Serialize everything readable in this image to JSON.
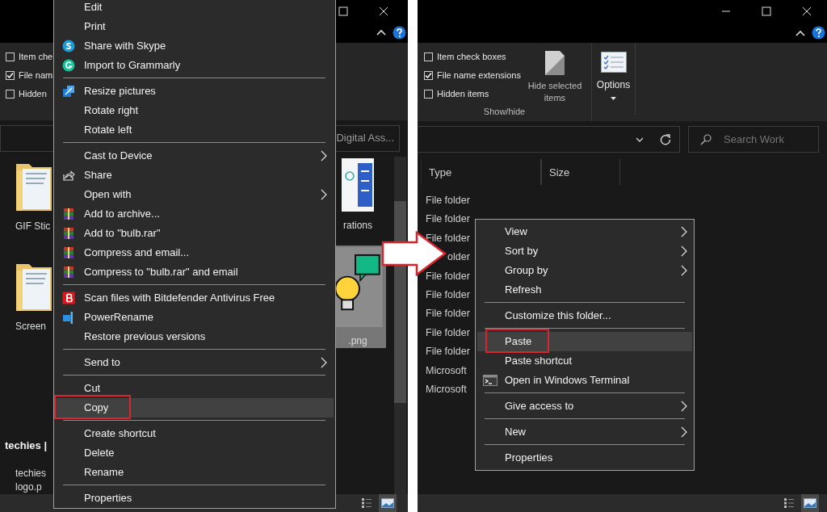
{
  "left_window": {
    "ribbon_checkboxes": [
      {
        "label": "Item che",
        "checked": false
      },
      {
        "label": "File nam",
        "checked": true
      },
      {
        "label": "Hidden",
        "checked": false
      }
    ],
    "address_text": "Digital Ass...",
    "files_left_of_menu": [
      {
        "kind": "folder",
        "name": "GIF Stic"
      },
      {
        "kind": "folder",
        "name": "Screen"
      },
      {
        "kind": "logo",
        "preview_text": "techies |",
        "name_lines": [
          "techies",
          "logo.p"
        ]
      }
    ],
    "files_right_of_menu": [
      {
        "kind": "image",
        "name": "rations",
        "selected": false
      },
      {
        "kind": "bulb",
        "name": ".png",
        "selected": true
      }
    ],
    "context_menu": [
      {
        "kind": "item",
        "label": "Edit",
        "submenu": false,
        "selected": false
      },
      {
        "kind": "item",
        "label": "Print",
        "submenu": false,
        "selected": false
      },
      {
        "kind": "item",
        "label": "Share with Skype",
        "submenu": false,
        "selected": false
      },
      {
        "kind": "item",
        "label": "Import to Grammarly",
        "submenu": false,
        "selected": false
      },
      {
        "kind": "separator"
      },
      {
        "kind": "item",
        "label": "Resize pictures",
        "submenu": false,
        "selected": false
      },
      {
        "kind": "item",
        "label": "Rotate right",
        "submenu": false,
        "selected": false
      },
      {
        "kind": "item",
        "label": "Rotate left",
        "submenu": false,
        "selected": false
      },
      {
        "kind": "separator"
      },
      {
        "kind": "item",
        "label": "Cast to Device",
        "submenu": true,
        "selected": false
      },
      {
        "kind": "item",
        "label": "Share",
        "submenu": false,
        "selected": false
      },
      {
        "kind": "item",
        "label": "Open with",
        "submenu": true,
        "selected": false
      },
      {
        "kind": "item",
        "label": "Add to archive...",
        "submenu": false,
        "selected": false
      },
      {
        "kind": "item",
        "label": "Add to \"bulb.rar\"",
        "submenu": false,
        "selected": false
      },
      {
        "kind": "item",
        "label": "Compress and email...",
        "submenu": false,
        "selected": false
      },
      {
        "kind": "item",
        "label": "Compress to \"bulb.rar\" and email",
        "submenu": false,
        "selected": false
      },
      {
        "kind": "separator"
      },
      {
        "kind": "item",
        "label": "Scan files with Bitdefender Antivirus Free",
        "submenu": false,
        "selected": false
      },
      {
        "kind": "item",
        "label": "PowerRename",
        "submenu": false,
        "selected": false
      },
      {
        "kind": "item",
        "label": "Restore previous versions",
        "submenu": false,
        "selected": false
      },
      {
        "kind": "separator"
      },
      {
        "kind": "item",
        "label": "Send to",
        "submenu": true,
        "selected": false
      },
      {
        "kind": "separator"
      },
      {
        "kind": "item",
        "label": "Cut",
        "submenu": false,
        "selected": false
      },
      {
        "kind": "item",
        "label": "Copy",
        "submenu": false,
        "selected": true
      },
      {
        "kind": "separator"
      },
      {
        "kind": "item",
        "label": "Create shortcut",
        "submenu": false,
        "selected": false
      },
      {
        "kind": "item",
        "label": "Delete",
        "submenu": false,
        "selected": false
      },
      {
        "kind": "item",
        "label": "Rename",
        "submenu": false,
        "selected": false
      },
      {
        "kind": "separator"
      },
      {
        "kind": "item",
        "label": "Properties",
        "submenu": false,
        "selected": false
      }
    ]
  },
  "right_window": {
    "ribbon_checkboxes": [
      {
        "label": "Item check boxes",
        "checked": false
      },
      {
        "label": "File name extensions",
        "checked": true
      },
      {
        "label": "Hidden items",
        "checked": false
      }
    ],
    "hide_selected_button": "Hide selected items",
    "options_button": "Options",
    "group_label": "Show/hide",
    "search": {
      "placeholder": "Search Work"
    },
    "columns": [
      "Type",
      "Size"
    ],
    "rows": [
      "File folder",
      "File folder",
      "File folder",
      "older",
      "File folder",
      "File folder",
      "File folder",
      "File folder",
      "File folder",
      "Microsoft",
      "Microsoft"
    ],
    "context_menu": [
      {
        "kind": "item",
        "label": "View",
        "submenu": true,
        "selected": false
      },
      {
        "kind": "item",
        "label": "Sort by",
        "submenu": true,
        "selected": false
      },
      {
        "kind": "item",
        "label": "Group by",
        "submenu": true,
        "selected": false
      },
      {
        "kind": "item",
        "label": "Refresh",
        "submenu": false,
        "selected": false
      },
      {
        "kind": "separator"
      },
      {
        "kind": "item",
        "label": "Customize this folder...",
        "submenu": false,
        "selected": false
      },
      {
        "kind": "separator"
      },
      {
        "kind": "item",
        "label": "Paste",
        "submenu": false,
        "selected": true
      },
      {
        "kind": "item",
        "label": "Paste shortcut",
        "submenu": false,
        "selected": false
      },
      {
        "kind": "item",
        "label": "Open in Windows Terminal",
        "submenu": false,
        "selected": false
      },
      {
        "kind": "separator"
      },
      {
        "kind": "item",
        "label": "Give access to",
        "submenu": true,
        "selected": false
      },
      {
        "kind": "separator"
      },
      {
        "kind": "item",
        "label": "New",
        "submenu": true,
        "selected": false
      },
      {
        "kind": "separator"
      },
      {
        "kind": "item",
        "label": "Properties",
        "submenu": false,
        "selected": false
      }
    ]
  }
}
